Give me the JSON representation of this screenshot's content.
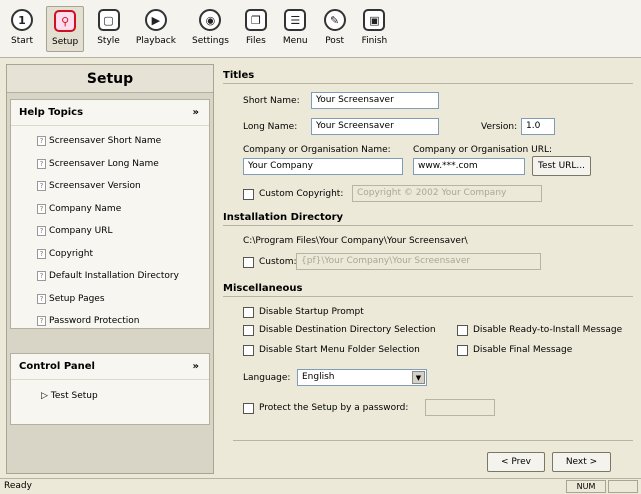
{
  "toolbar": {
    "items": [
      {
        "label": "Start",
        "icon": "start-icon",
        "glyph": "1"
      },
      {
        "label": "Setup",
        "icon": "setup-icon",
        "glyph": "⚲"
      },
      {
        "label": "Style",
        "icon": "style-icon",
        "glyph": "▢"
      },
      {
        "label": "Playback",
        "icon": "playback-icon",
        "glyph": "▶"
      },
      {
        "label": "Settings",
        "icon": "settings-icon",
        "glyph": "◉"
      },
      {
        "label": "Files",
        "icon": "files-icon",
        "glyph": "❐"
      },
      {
        "label": "Menu",
        "icon": "menu-icon",
        "glyph": "☰"
      },
      {
        "label": "Post",
        "icon": "post-icon",
        "glyph": "✎"
      },
      {
        "label": "Finish",
        "icon": "finish-icon",
        "glyph": "▣"
      }
    ]
  },
  "sidebar": {
    "title": "Setup",
    "help_topics": {
      "header": "Help Topics",
      "items": [
        "Screensaver Short Name",
        "Screensaver Long Name",
        "Screensaver Version",
        "Company Name",
        "Company URL",
        "Copyright",
        "Default Installation Directory",
        "Setup Pages",
        "Password Protection"
      ]
    },
    "control_panel": {
      "header": "Control Panel",
      "items": [
        "Test Setup"
      ]
    }
  },
  "titles": {
    "heading": "Titles",
    "short_name_label": "Short Name:",
    "short_name_value": "Your Screensaver",
    "long_name_label": "Long Name:",
    "long_name_value": "Your Screensaver",
    "version_label": "Version:",
    "version_value": "1.0",
    "company_label": "Company or Organisation Name:",
    "company_value": "Your Company",
    "url_label": "Company or Organisation URL:",
    "url_value": "www.***.com",
    "test_url_button": "Test URL...",
    "custom_copyright_label": "Custom Copyright:",
    "custom_copyright_value": "Copyright © 2002 Your Company"
  },
  "install": {
    "heading": "Installation Directory",
    "path": "C:\\Program Files\\Your Company\\Your Screensaver\\",
    "custom_label": "Custom:",
    "custom_value": "{pf}\\Your Company\\Your Screensaver"
  },
  "misc": {
    "heading": "Miscellaneous",
    "disable_startup": "Disable Startup Prompt",
    "disable_dest": "Disable Destination Directory Selection",
    "disable_ready": "Disable Ready-to-Install Message",
    "disable_startmenu": "Disable Start Menu Folder Selection",
    "disable_final": "Disable Final Message",
    "language_label": "Language:",
    "language_value": "English",
    "protect_label": "Protect the Setup by a password:"
  },
  "nav": {
    "prev": "< Prev",
    "next": "Next >"
  },
  "status": {
    "text": "Ready",
    "num": "NUM"
  }
}
